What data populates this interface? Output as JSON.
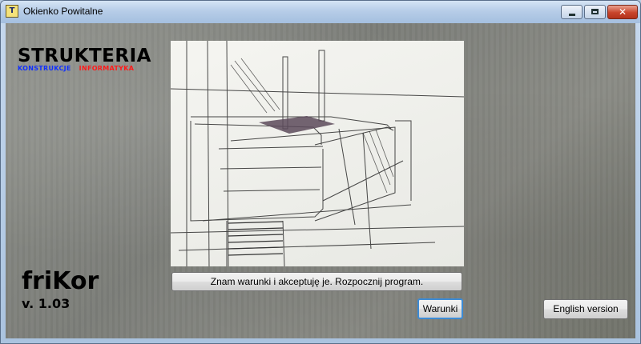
{
  "window": {
    "title": "Okienko Powitalne"
  },
  "logo": {
    "main": "STRUKTERIA",
    "sub_left": "KONSTRUKCJE",
    "sub_right": "INFORMATYKA"
  },
  "product": {
    "name": "friKor",
    "version": "v. 1.03"
  },
  "buttons": {
    "accept": "Znam warunki i akceptuję je. Rozpocznij program.",
    "terms": "Warunki",
    "english": "English version"
  },
  "colors": {
    "logo_blue": "#1030ff",
    "logo_red": "#ff1a1a",
    "focus": "#3c8bd6"
  }
}
